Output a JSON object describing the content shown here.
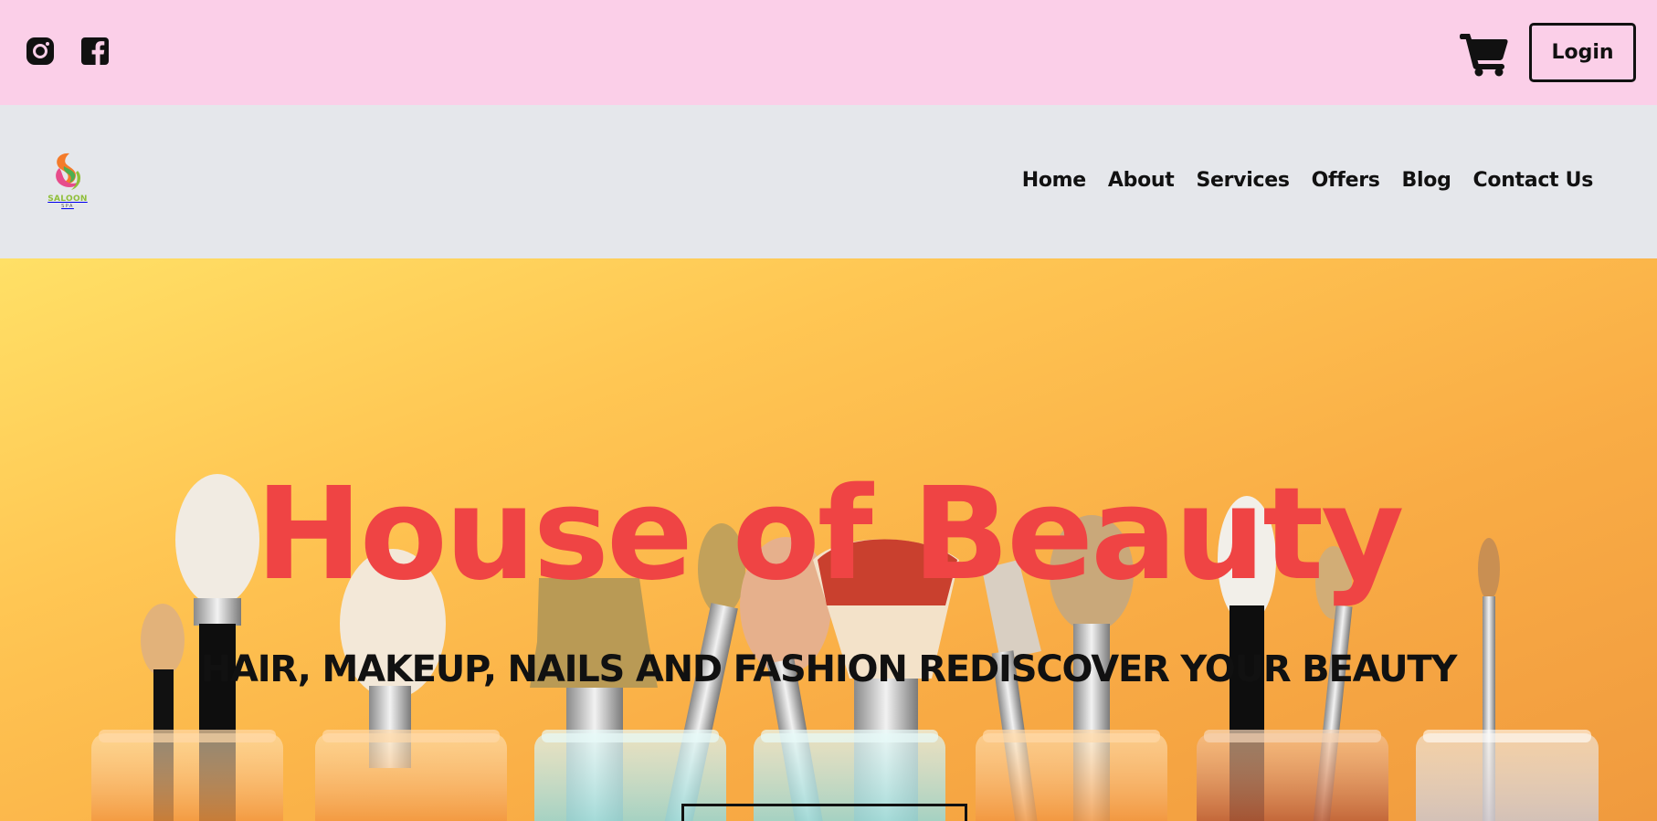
{
  "topbar": {
    "background": "#fbcfe8",
    "social": [
      {
        "name": "instagram",
        "icon": "instagram-icon"
      },
      {
        "name": "facebook",
        "icon": "facebook-icon"
      }
    ],
    "cart_icon": "shopping-cart-icon",
    "login_label": "Login"
  },
  "navbar": {
    "background": "#e5e7eb",
    "logo": {
      "name": "SALOON",
      "subtitle": "SPA"
    },
    "links": [
      {
        "label": "Home"
      },
      {
        "label": "About"
      },
      {
        "label": "Services"
      },
      {
        "label": "Offers"
      },
      {
        "label": "Blog"
      },
      {
        "label": "Contact Us"
      }
    ]
  },
  "hero": {
    "title": "House of Beauty",
    "subtitle": "HAIR, MAKEUP, NAILS AND FASHION REDISCOVER YOUR BEAUTY",
    "title_color": "#ef4444",
    "background": "makeup-brushes-in-jars-image"
  }
}
